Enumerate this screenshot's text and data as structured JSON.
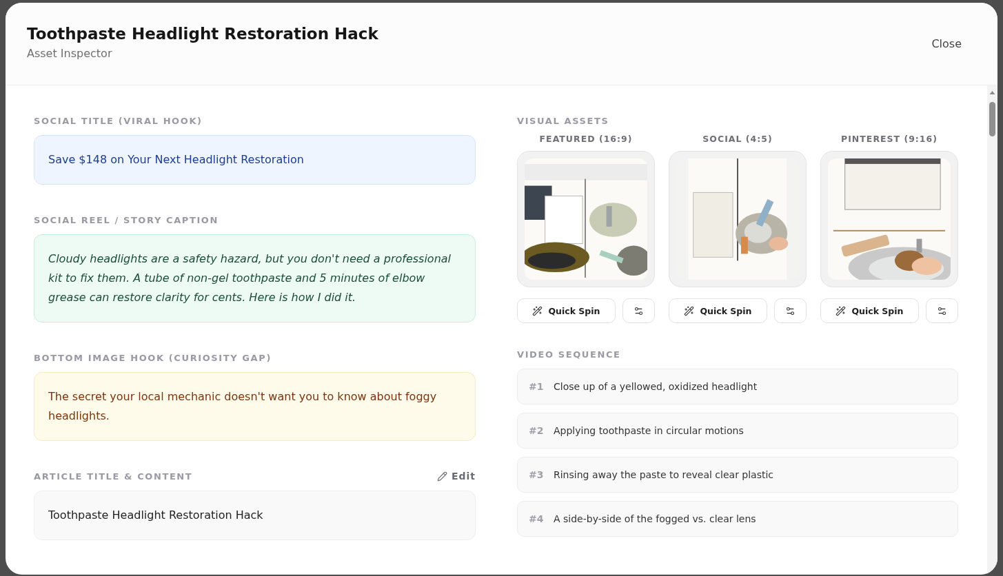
{
  "header": {
    "title": "Toothpaste Headlight Restoration Hack",
    "subtitle": "Asset Inspector",
    "close": "Close"
  },
  "sections": [
    {
      "label": "SOCIAL TITLE (VIRAL HOOK)",
      "kind": "hook",
      "text": "Save $148 on Your Next Headlight Restoration"
    },
    {
      "label": "SOCIAL REEL / STORY CAPTION",
      "kind": "caption",
      "text": "Cloudy headlights are a safety hazard, but you don't need a professional kit to fix them. A tube of non-gel toothpaste and 5 minutes of elbow grease can restore clarity for cents. Here is how I did it."
    },
    {
      "label": "BOTTOM IMAGE HOOK (CURIOSITY GAP)",
      "kind": "image_hook",
      "text": "The secret your local mechanic doesn't want you to know about foggy headlights."
    },
    {
      "label": "ARTICLE TITLE & CONTENT",
      "kind": "article",
      "text": "Toothpaste Headlight Restoration Hack",
      "action": "Edit"
    }
  ],
  "visual_assets": {
    "label": "VISUAL ASSETS",
    "assets": [
      {
        "label": "FEATURED (16:9)",
        "kind": "picture",
        "button": "Quick Spin"
      },
      {
        "label": "SOCIAL (4:5)",
        "kind": "picture",
        "button": "Quick Spin"
      },
      {
        "label": "PINTEREST (9:16)",
        "kind": "picture",
        "button": "Quick Spin"
      }
    ]
  },
  "video_sequence": {
    "label": "VIDEO SEQUENCE",
    "steps": [
      {
        "number": "#1",
        "text": "Close up of a yellowed, oxidized headlight"
      },
      {
        "number": "#2",
        "text": "Applying toothpaste in circular motions"
      },
      {
        "number": "#3",
        "text": "Rinsing away the paste to reveal clear plastic"
      },
      {
        "number": "#4",
        "text": "A side-by-side of the fogged vs. clear lens"
      }
    ]
  }
}
